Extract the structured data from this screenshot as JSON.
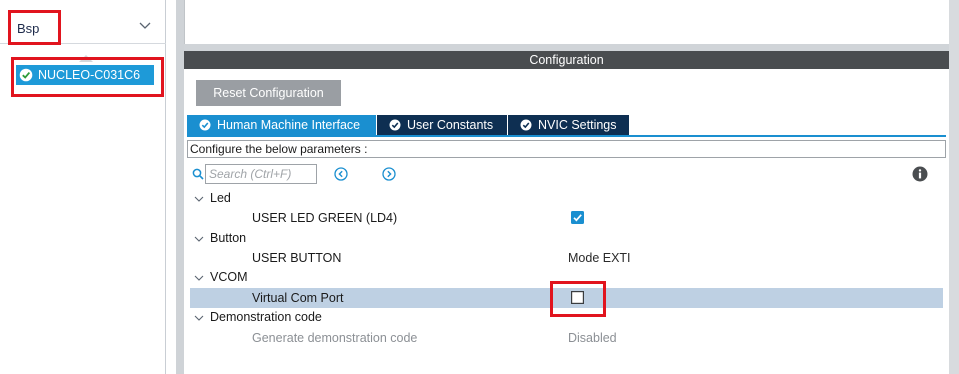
{
  "sidebar": {
    "category": "Bsp",
    "board_item": "NUCLEO-C031C6"
  },
  "config": {
    "header": "Configuration",
    "reset_button": "Reset Configuration",
    "tabs": [
      {
        "label": "Human Machine Interface",
        "active": true
      },
      {
        "label": "User Constants",
        "active": false
      },
      {
        "label": "NVIC Settings",
        "active": false
      }
    ],
    "params_caption": "Configure the below parameters :",
    "search_placeholder": "Search (Ctrl+F)"
  },
  "tree": [
    {
      "type": "group",
      "label": "Led"
    },
    {
      "type": "param",
      "label": "USER LED GREEN (LD4)",
      "value_kind": "checkbox",
      "checked": true
    },
    {
      "type": "group",
      "label": "Button"
    },
    {
      "type": "param",
      "label": "USER BUTTON",
      "value_kind": "text",
      "value": "Mode EXTI"
    },
    {
      "type": "group",
      "label": "VCOM"
    },
    {
      "type": "param",
      "label": "Virtual Com Port",
      "value_kind": "checkbox",
      "checked": false,
      "selected": true
    },
    {
      "type": "group",
      "label": "Demonstration code"
    },
    {
      "type": "param",
      "label": "Generate demonstration code",
      "value_kind": "text",
      "value": "Disabled",
      "disabled": true
    }
  ],
  "colors": {
    "accent": "#1a8fd0",
    "tab_dark": "#0e2f52",
    "highlight": "#e1141e",
    "header_bg": "#4a4d50",
    "selected_row": "#bed0e3"
  }
}
